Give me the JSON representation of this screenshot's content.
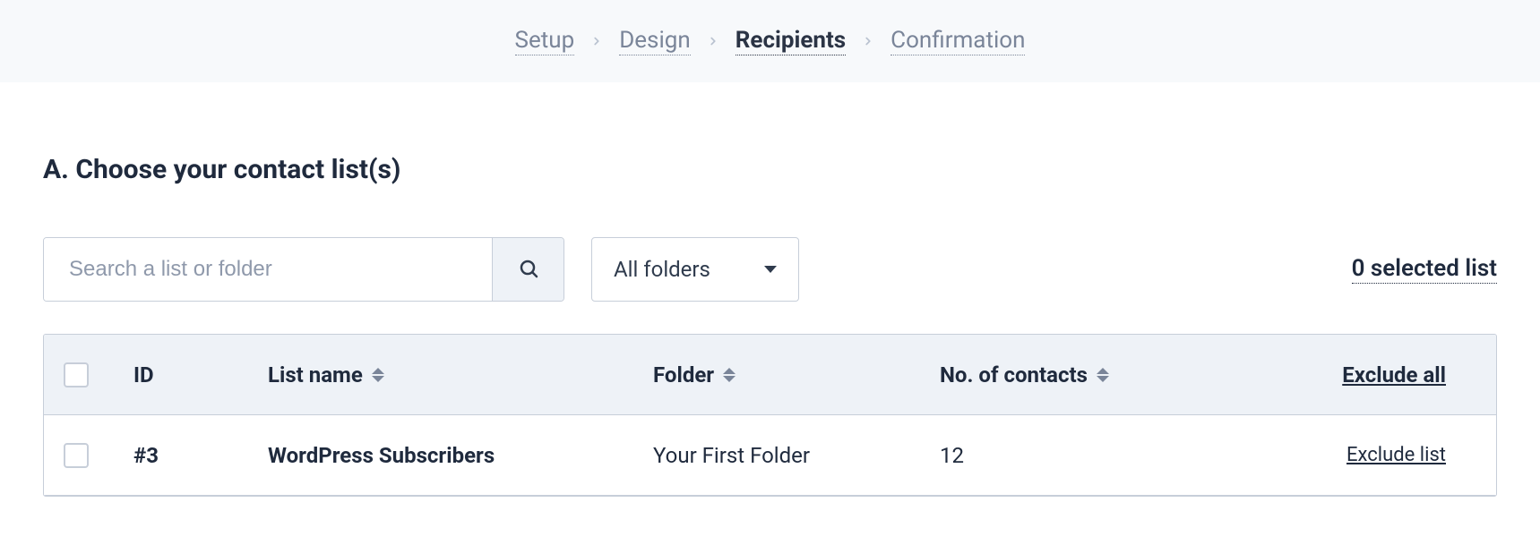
{
  "breadcrumb": {
    "items": [
      {
        "label": "Setup",
        "active": false
      },
      {
        "label": "Design",
        "active": false
      },
      {
        "label": "Recipients",
        "active": true
      },
      {
        "label": "Confirmation",
        "active": false
      }
    ]
  },
  "section": {
    "title": "A. Choose your contact list(s)"
  },
  "search": {
    "placeholder": "Search a list or folder",
    "value": ""
  },
  "folderSelect": {
    "selected": "All folders"
  },
  "selected": {
    "text": "0 selected list"
  },
  "table": {
    "headers": {
      "id": "ID",
      "name": "List name",
      "folder": "Folder",
      "count": "No. of contacts",
      "excludeAll": "Exclude all"
    },
    "rows": [
      {
        "id": "#3",
        "name": "WordPress Subscribers",
        "folder": "Your First Folder",
        "count": "12",
        "action": "Exclude list"
      }
    ]
  }
}
